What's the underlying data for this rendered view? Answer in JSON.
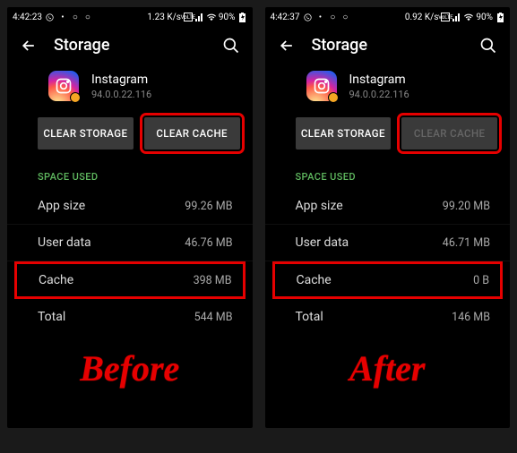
{
  "panels": [
    {
      "status": {
        "time": "4:42:23",
        "speed": "1.23 K/s",
        "battery": "90%"
      },
      "page_title": "Storage",
      "app": {
        "name": "Instagram",
        "version": "94.0.0.22.116"
      },
      "buttons": {
        "clear_storage": "CLEAR STORAGE",
        "clear_cache": "CLEAR CACHE",
        "cache_disabled": false,
        "cache_highlight": true
      },
      "section": "SPACE USED",
      "rows": {
        "app_size": {
          "label": "App size",
          "value": "99.26 MB"
        },
        "user_data": {
          "label": "User data",
          "value": "46.76 MB"
        },
        "cache": {
          "label": "Cache",
          "value": "398 MB",
          "highlight": true
        },
        "total": {
          "label": "Total",
          "value": "544 MB"
        }
      },
      "caption": "Before"
    },
    {
      "status": {
        "time": "4:42:37",
        "speed": "0.92 K/s",
        "battery": "90%"
      },
      "page_title": "Storage",
      "app": {
        "name": "Instagram",
        "version": "94.0.0.22.116"
      },
      "buttons": {
        "clear_storage": "CLEAR STORAGE",
        "clear_cache": "CLEAR CACHE",
        "cache_disabled": true,
        "cache_highlight": true
      },
      "section": "SPACE USED",
      "rows": {
        "app_size": {
          "label": "App size",
          "value": "99.20 MB"
        },
        "user_data": {
          "label": "User data",
          "value": "46.71 MB"
        },
        "cache": {
          "label": "Cache",
          "value": "0 B",
          "highlight": true
        },
        "total": {
          "label": "Total",
          "value": "146 MB"
        }
      },
      "caption": "After"
    }
  ]
}
